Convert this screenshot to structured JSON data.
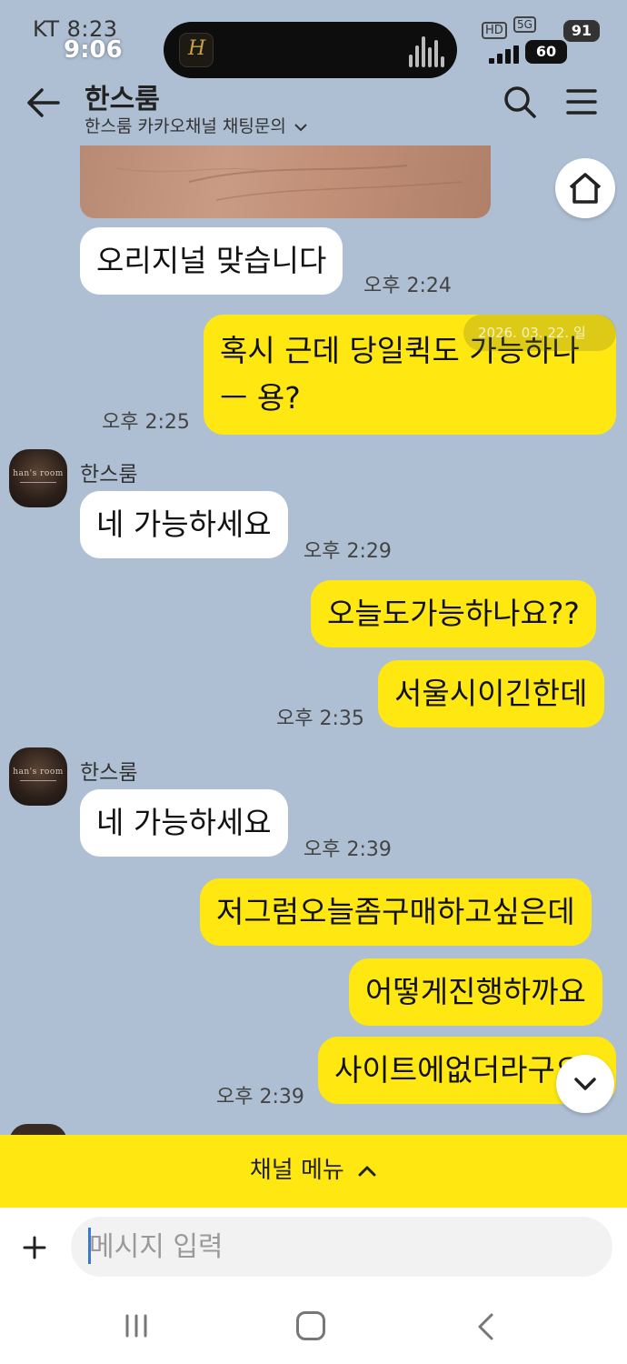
{
  "status_bar": {
    "carrier_time": "KT 8:23",
    "overlay_time": "9:06",
    "hd": "HD",
    "network": "5G",
    "battery_top": "91",
    "battery_bottom": "60"
  },
  "header": {
    "title": "한스룸",
    "subtitle": "한스룸 카카오채널 채팅문의"
  },
  "date_overlay": "2026. 03. 22. 일",
  "messages": [
    {
      "side": "in",
      "text": "오리지널 맞습니다",
      "time": "오후 2:24"
    },
    {
      "side": "out",
      "line1": "혹시 근데 당일퀵도 가능하나",
      "line2": "ㅡ 용?",
      "time": "오후 2:25"
    },
    {
      "side": "in",
      "sender": "한스룸",
      "text": "네 가능하세요",
      "time": "오후 2:29"
    },
    {
      "side": "out",
      "text": "오늘도가능하나요??"
    },
    {
      "side": "out",
      "text": "서울시이긴한데",
      "time": "오후 2:35"
    },
    {
      "side": "in",
      "sender": "한스룸",
      "text": "네 가능하세요",
      "time": "오후 2:39"
    },
    {
      "side": "out",
      "text": "저그럼오늘좀구매하고싶은데"
    },
    {
      "side": "out",
      "text": "어떻게진행하까요"
    },
    {
      "side": "out",
      "text": "사이트에없더라구요",
      "time": "오후 2:39"
    }
  ],
  "avatar_text": "han's room",
  "channel_menu": {
    "label": "채널 메뉴",
    "chevron": "^"
  },
  "input": {
    "placeholder": "메시지 입력",
    "plus": "+"
  },
  "icons": {
    "back": "arrow-left-icon",
    "search": "search-icon",
    "menu": "hamburger-icon",
    "home": "home-icon",
    "scroll": "chevron-down-icon"
  },
  "colors": {
    "chat_bg": "#aebfd3",
    "outgoing_bubble": "#ffe812",
    "incoming_bubble": "#ffffff",
    "channel_bar": "#ffe812"
  }
}
